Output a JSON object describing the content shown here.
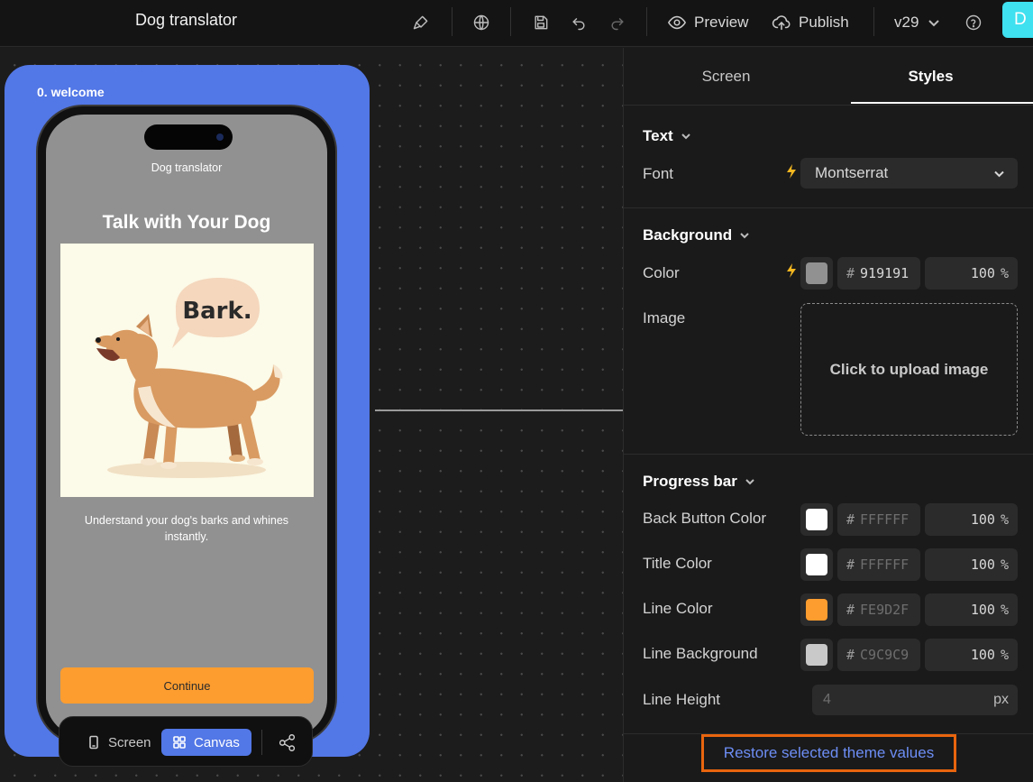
{
  "topbar": {
    "app_title": "Dog translator",
    "preview_label": "Preview",
    "publish_label": "Publish",
    "version": "v29",
    "avatar_initial": "D"
  },
  "canvas": {
    "frame_label": "0. welcome",
    "screen": {
      "header": "Dog translator",
      "title": "Talk with Your Dog",
      "bubble_text": "Bark.",
      "description": "Understand your dog's barks and whines instantly.",
      "continue_label": "Continue",
      "background_color": "#919191",
      "button_color": "#FE9D2F"
    },
    "view_toggle": {
      "screen_label": "Screen",
      "canvas_label": "Canvas",
      "active": "Canvas"
    }
  },
  "panel": {
    "tabs": {
      "screen": "Screen",
      "styles": "Styles",
      "active": "Styles"
    },
    "text_section": {
      "heading": "Text",
      "font_label": "Font",
      "font_value": "Montserrat"
    },
    "background_section": {
      "heading": "Background",
      "color_label": "Color",
      "color_hex": "919191",
      "color_opacity": "100",
      "image_label": "Image",
      "upload_label": "Click to upload image"
    },
    "progress_section": {
      "heading": "Progress bar",
      "rows": [
        {
          "label": "Back Button Color",
          "hex": "FFFFFF",
          "opacity": "100",
          "swatch": "#FFFFFF"
        },
        {
          "label": "Title Color",
          "hex": "FFFFFF",
          "opacity": "100",
          "swatch": "#FFFFFF"
        },
        {
          "label": "Line Color",
          "hex": "FE9D2F",
          "opacity": "100",
          "swatch": "#FE9D2F"
        },
        {
          "label": "Line Background",
          "hex": "C9C9C9",
          "opacity": "100",
          "swatch": "#C9C9C9"
        }
      ],
      "line_height_label": "Line Height",
      "line_height_value": "4",
      "line_height_unit": "px"
    },
    "hash": "#",
    "percent": "%",
    "restore_label": "Restore selected theme values"
  },
  "colors": {
    "accent_blue": "#5277E6",
    "cyan_avatar": "#3FE0EF",
    "restore_border": "#E8650E",
    "bolt": "#F5B820"
  }
}
